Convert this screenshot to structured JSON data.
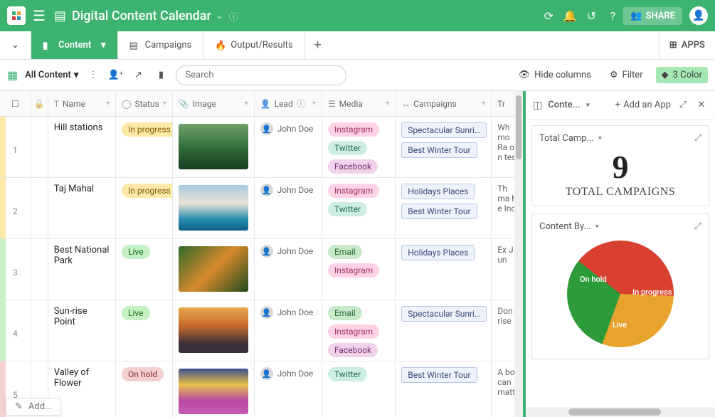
{
  "header": {
    "title": "Digital Content Calendar",
    "share_label": "SHARE"
  },
  "tabs": [
    {
      "label": "Content",
      "active": true
    },
    {
      "label": "Campaigns",
      "active": false
    },
    {
      "label": "Output/Results",
      "active": false
    }
  ],
  "apps_label": "APPS",
  "toolbar": {
    "view_label": "All Content",
    "search_placeholder": "Search",
    "hide_cols": "Hide columns",
    "filter": "Filter",
    "colors": "3 Color"
  },
  "columns": {
    "name": "Name",
    "status": "Status",
    "image": "Image",
    "lead": "Lead",
    "media": "Media",
    "campaigns": "Campaigns",
    "trans": "Tr"
  },
  "rows": [
    {
      "num": "1",
      "strip": "#ffe9a8",
      "name": "Hill stations",
      "status": "In progress",
      "status_cls": "inprog",
      "thumb_css": "linear-gradient(180deg,#6fa26a 0%,#2f6b3a 55%,#1a3f24 100%)",
      "lead": "John Doe",
      "media": [
        {
          "t": "Instagram",
          "c": "ig"
        },
        {
          "t": "Twitter",
          "c": "tw"
        },
        {
          "t": "Facebook",
          "c": "fb"
        }
      ],
      "campaigns": [
        "Spectacular Sunrise...",
        "Best Winter Tour"
      ],
      "trans": "Wh mo Ra on tes"
    },
    {
      "num": "2",
      "strip": "#ffe9a8",
      "name": "Taj Mahal",
      "status": "In progress",
      "status_cls": "inprog",
      "thumb_css": "linear-gradient(180deg,#a8c9e0 0%,#e9e3d4 40%,#2a8cb3 75%,#0f5f82 100%)",
      "lead": "John Doe",
      "media": [
        {
          "t": "Instagram",
          "c": "ig"
        },
        {
          "t": "Twitter",
          "c": "tw"
        }
      ],
      "campaigns": [
        "Holidays Places",
        "Best Winter Tour"
      ],
      "trans": "Th ma he Ind"
    },
    {
      "num": "3",
      "strip": "#c4f0c4",
      "name": "Best National Park",
      "status": "Live",
      "status_cls": "live",
      "thumb_css": "linear-gradient(135deg,#2f6b2a 0%,#d98a2e 50%,#1f4a1c 100%)",
      "lead": "John Doe",
      "media": [
        {
          "t": "Email",
          "c": "em"
        },
        {
          "t": "Instagram",
          "c": "ig"
        }
      ],
      "campaigns": [
        "Holidays Places"
      ],
      "trans": "Ex Jun"
    },
    {
      "num": "4",
      "strip": "#c4f0c4",
      "name": "Sun-rise Point",
      "status": "Live",
      "status_cls": "live",
      "thumb_css": "linear-gradient(180deg,#e8a94a 0%,#c96b2a 40%,#3a2f3a 80%)",
      "lead": "John Doe",
      "media": [
        {
          "t": "Email",
          "c": "em"
        },
        {
          "t": "Instagram",
          "c": "ig"
        },
        {
          "t": "Facebook",
          "c": "fb"
        }
      ],
      "campaigns": [
        "Spectacular Sunrise..."
      ],
      "trans": "Don rise"
    },
    {
      "num": "5",
      "strip": "#f4d0d0",
      "name": "Valley of Flower",
      "status": "On hold",
      "status_cls": "hold",
      "thumb_css": "linear-gradient(180deg,#3a4f8c 0%,#e8c04a 35%,#b84aa0 70%,#c95ab5 100%)",
      "lead": "John Doe",
      "media": [
        {
          "t": "Twitter",
          "c": "tw"
        }
      ],
      "campaigns": [
        "Best Winter Tour"
      ],
      "trans": "A bo can matt"
    }
  ],
  "addrow": "Add...",
  "sidepanel": {
    "header_label": "Conte...",
    "add_app": "Add an App",
    "card1_title": "Total Camp...",
    "card1_value": "9",
    "card1_label": "TOTAL CAMPAIGNS",
    "card2_title": "Content By..."
  },
  "chart_data": {
    "type": "pie",
    "title": "Content By Status",
    "series": [
      {
        "name": "On hold",
        "value": 30,
        "color": "#2e9b3a"
      },
      {
        "name": "In progress",
        "value": 40,
        "color": "#d8412f"
      },
      {
        "name": "Live",
        "value": 30,
        "color": "#e8a32e"
      }
    ]
  }
}
